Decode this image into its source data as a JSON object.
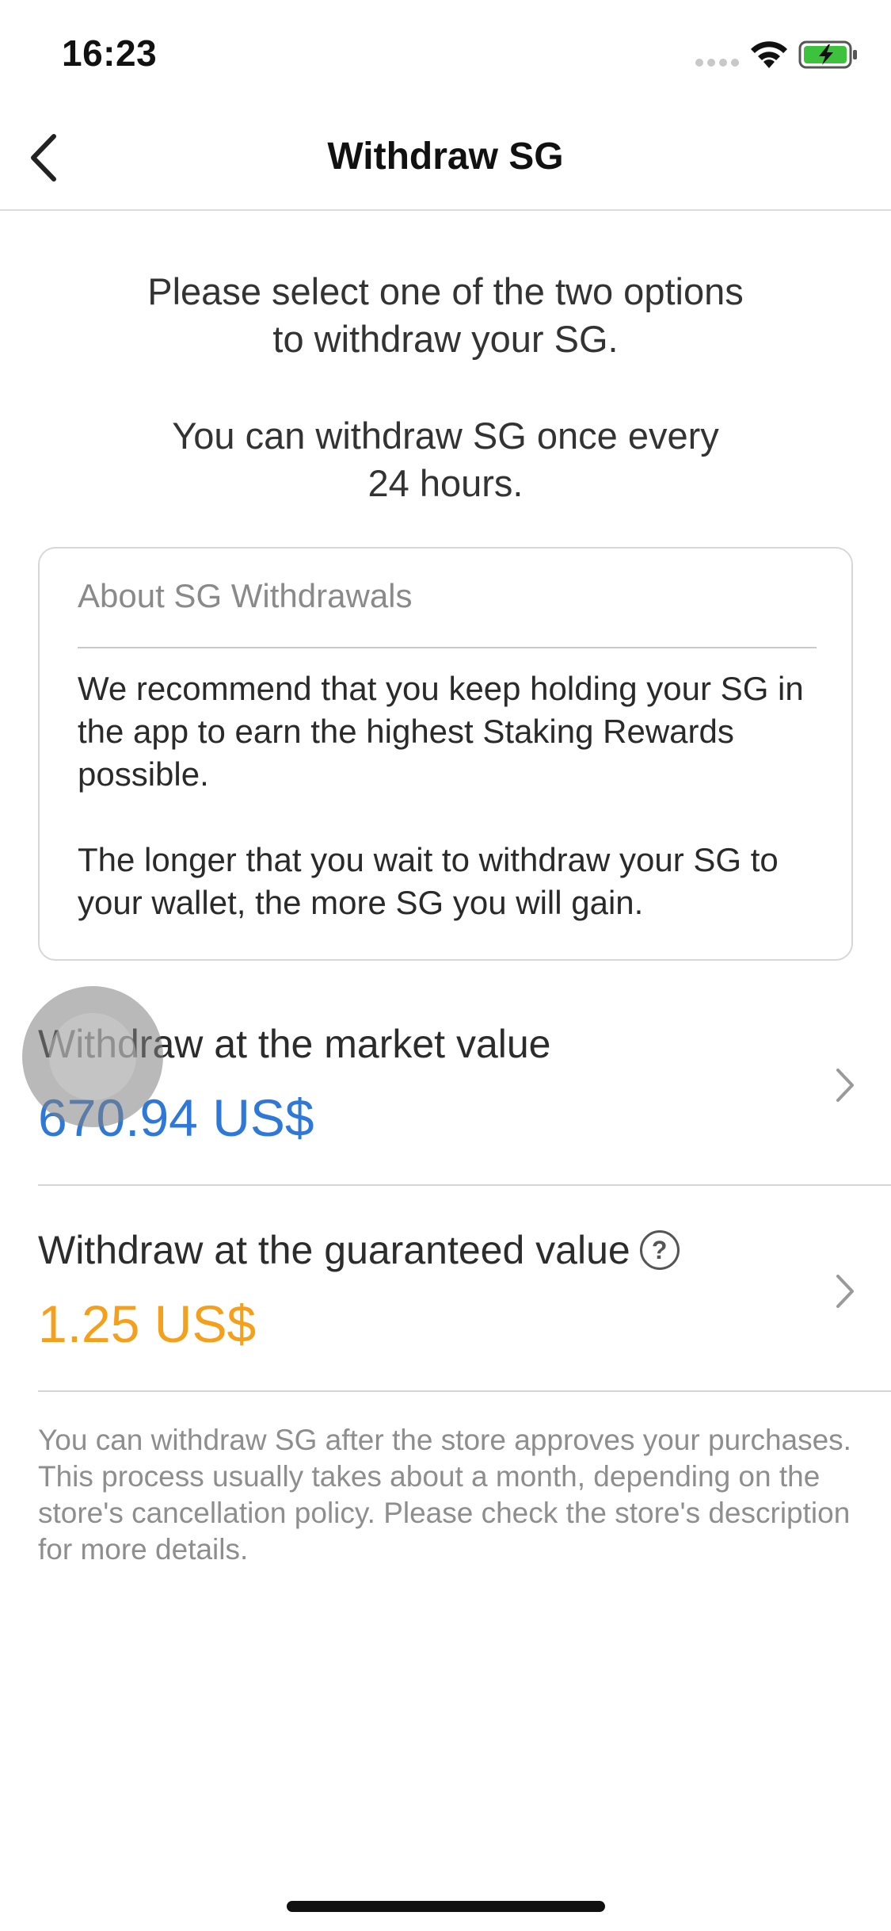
{
  "status_bar": {
    "time": "16:23",
    "icons": [
      "signal-dots-icon",
      "wifi-icon",
      "battery-charging-icon"
    ],
    "battery_color": "#3cc23c"
  },
  "nav": {
    "back_icon": "chevron-left-icon",
    "title": "Withdraw SG"
  },
  "intro": {
    "line1": "Please select one of the two options\nto withdraw your SG.",
    "line2": "You can withdraw SG once every\n24 hours."
  },
  "about": {
    "title": "About SG Withdrawals",
    "paragraph1": "We recommend that you keep holding your SG in the app to earn the highest Staking Rewards possible.",
    "paragraph2": "The longer that you wait to withdraw your SG to your wallet, the more SG you will gain."
  },
  "options": [
    {
      "label": "Withdraw at the market value",
      "value": "670.94 US$",
      "value_color": "#2f78d8",
      "has_help_icon": false
    },
    {
      "label": "Withdraw at the guaranteed value",
      "value": "1.25 US$",
      "value_color": "#f5a01c",
      "has_help_icon": true,
      "help_icon_text": "?"
    }
  ],
  "footnote": "You can withdraw SG after the store approves your purchases. This process usually takes about a month, depending on the store's cancellation policy. Please check the store's description for more details."
}
